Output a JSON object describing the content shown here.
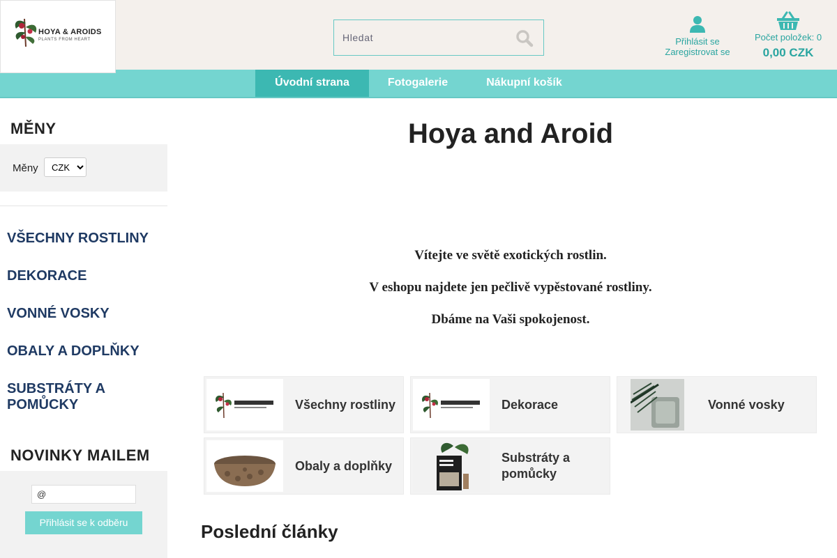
{
  "brand": {
    "logo_line1": "HOYA & AROIDS",
    "logo_line2": "PLANTS FROM HEART",
    "accent_color": "#74d5d0",
    "accent_dark": "#3cb8b2",
    "link_color": "#2aa5a0",
    "category_color": "#1f3a63"
  },
  "header": {
    "search_placeholder": "Hledat",
    "search_icon": "search-icon",
    "user_icon": "user-icon",
    "login_label": "Přihlásit se",
    "register_label": "Zaregistrovat se",
    "cart_icon": "basket-icon",
    "cart_count_label": "Počet položek: 0",
    "cart_price": "0,00 CZK"
  },
  "nav": {
    "items": [
      {
        "label": "Úvodní strana",
        "active": true
      },
      {
        "label": "Fotogalerie",
        "active": false
      },
      {
        "label": "Nákupní košík",
        "active": false
      }
    ]
  },
  "sidebar": {
    "currency_heading": "MĚNY",
    "currency_label": "Měny",
    "currency_selected": "CZK",
    "categories": [
      "VŠECHNY ROSTLINY",
      "DEKORACE",
      "VONNÉ VOSKY",
      "OBALY A DOPLŇKY",
      "SUBSTRÁTY A POMŮCKY"
    ],
    "newsletter_heading": "NOVINKY MAILEM",
    "newsletter_value": "@",
    "newsletter_button": "Přihlásit se k odběru"
  },
  "main": {
    "title": "Hoya and Aroid",
    "intro": [
      "Vítejte ve světě exotických rostlin.",
      "V eshopu najdete jen pečlivě vypěstované rostliny.",
      "Dbáme na Vaši spokojenost."
    ],
    "tiles": [
      {
        "label": "Všechny rostliny",
        "image": "logo"
      },
      {
        "label": "Dekorace",
        "image": "logo"
      },
      {
        "label": "Vonné vosky",
        "image": "wax-melts"
      },
      {
        "label": "Obaly a doplňky",
        "image": "pot"
      },
      {
        "label": "Substráty a pomůcky",
        "image": "soil-bag"
      }
    ],
    "last_articles_heading": "Poslední články"
  }
}
